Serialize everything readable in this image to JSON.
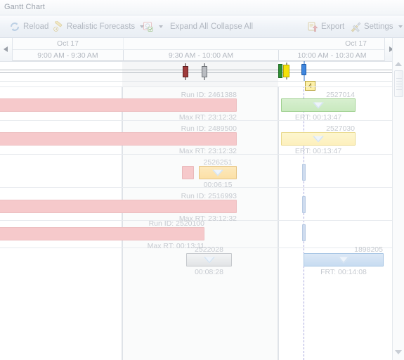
{
  "window": {
    "title": "Gantt Chart"
  },
  "toolbar": {
    "reload_label": "Reload",
    "forecasts_label": "Realistic Forecasts",
    "filter_label": "",
    "expand_all_label": "Expand All",
    "collapse_all_label": "Collapse All",
    "export_label": "Export",
    "settings_label": "Settings",
    "icons": {
      "reload": "reload-icon",
      "forecasts": "wand-icon",
      "filter": "filter-icon",
      "export": "export-icon",
      "settings": "tools-icon"
    }
  },
  "timeline": {
    "scroll_left_icon": "scroll-left-arrow",
    "scroll_right_icon": "scroll-right-arrow",
    "days": [
      {
        "label": "Oct 17"
      },
      {
        "label": "Oct 17"
      }
    ],
    "slots": [
      {
        "label": "9:00 AM - 9:30 AM"
      },
      {
        "label": "9:30 AM - 10:00 AM"
      },
      {
        "label": "10:00 AM - 10:30 AM"
      }
    ]
  },
  "markers": [
    {
      "name": "marker-dark-red",
      "color": "#9e3b3b"
    },
    {
      "name": "marker-grey",
      "color": "#8e9196"
    },
    {
      "name": "marker-green",
      "color": "#2f8f34"
    },
    {
      "name": "marker-yellow",
      "color": "#f4e10a"
    },
    {
      "name": "marker-blue",
      "color": "#1f6fd0"
    }
  ],
  "flag": {
    "label": "4"
  },
  "bars": [
    {
      "name": "actual-bar-run-2461388",
      "type": "pink",
      "row": 1
    },
    {
      "name": "forecast-bar-2527014",
      "type": "green",
      "row": 1
    },
    {
      "name": "actual-bar-run-2489500",
      "type": "pink",
      "row": 2
    },
    {
      "name": "forecast-bar-2527030",
      "type": "yellow",
      "row": 2
    },
    {
      "name": "chip-bar-2526251",
      "type": "pinkchip",
      "row": 3
    },
    {
      "name": "forecast-bar-2526251",
      "type": "orange",
      "row": 3
    },
    {
      "name": "actual-bar-run-2516993",
      "type": "pink",
      "row": 4
    },
    {
      "name": "actual-bar-run-2520100",
      "type": "pink",
      "row": 5
    },
    {
      "name": "forecast-bar-2522028",
      "type": "grey",
      "row": 6
    },
    {
      "name": "forecast-bar-1898205",
      "type": "blue",
      "row": 6
    }
  ],
  "labels": {
    "run_1_top": "Run ID: 2461388",
    "run_1_bottom": "Max RT: 23:12:32",
    "fc_1_top": "2527014",
    "fc_1_bottom": "ERT: 00:13:47",
    "run_2_top": "Run ID: 2489500",
    "run_2_bottom": "Max RT: 23:12:32",
    "fc_2_top": "2527030",
    "fc_2_bottom": "ERT: 00:13:47",
    "fc_3_top": "2526251",
    "fc_3_bottom": "00:06:15",
    "run_4_top": "Run ID: 2516993",
    "run_4_bottom": "Max RT: 23:12:32",
    "run_5_top": "Run ID: 2520100",
    "run_5_bottom": "Max RT: 00:13:11",
    "fc_6_top": "2522028",
    "fc_6_bottom": "00:08:28",
    "fc_7_top": "1898205",
    "fc_7_bottom": "FRT: 00:14:08"
  },
  "colors": {
    "pink": "#f6c9cb",
    "green": "#c9e9bf",
    "yellow": "#fdf0bd",
    "orange": "#fbe0a6",
    "grey": "#e2e4e6",
    "blue": "#c7dcf1",
    "now_line": "#a9a9de",
    "text": "#c6cad0"
  }
}
